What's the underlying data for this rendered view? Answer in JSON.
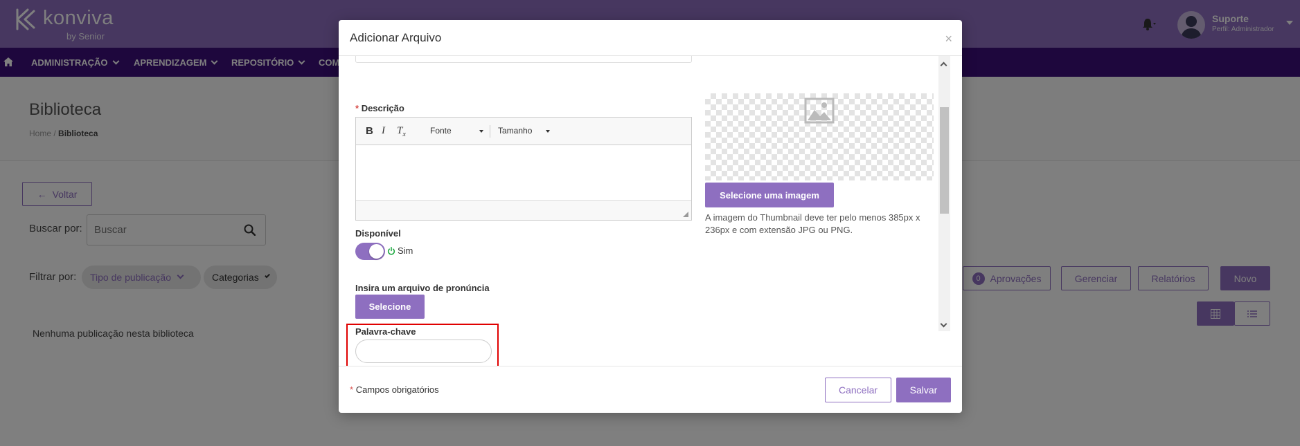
{
  "colors": {
    "brand": "#8e6fc0",
    "nav": "#3c0f7a",
    "highlight": "#e00000",
    "required": "#d9534f"
  },
  "app": {
    "logo_text": "konviva",
    "logo_by": "by Senior"
  },
  "user": {
    "name": "Suporte",
    "role": "Perfil: Administrador"
  },
  "nav": {
    "items": [
      {
        "label": "ADMINISTRAÇÃO"
      },
      {
        "label": "APRENDIZAGEM"
      },
      {
        "label": "REPOSITÓRIO"
      },
      {
        "label": "COM"
      }
    ]
  },
  "page": {
    "title": "Biblioteca",
    "breadcrumb": {
      "home": "Home",
      "sep": "/",
      "current": "Biblioteca"
    },
    "back_label": "Voltar",
    "search_label": "Buscar por:",
    "search_placeholder": "Buscar",
    "filter_label": "Filtrar por:",
    "filter_publication": "Tipo de publicação",
    "filter_categories": "Categorias",
    "approvals_count": "0",
    "approvals_label": "Aprovações",
    "manage_label": "Gerenciar",
    "reports_label": "Relatórios",
    "new_label": "Novo",
    "empty_message": "Nenhuma publicação nesta biblioteca"
  },
  "modal": {
    "title": "Adicionar Arquivo",
    "close_glyph": "×",
    "description": {
      "required_mark": "*",
      "label": "Descrição",
      "toolbar": {
        "bold": "B",
        "italic": "I",
        "clear": "Tx",
        "font": "Fonte",
        "size": "Tamanho"
      }
    },
    "available": {
      "label": "Disponível",
      "state_label": "Sim",
      "on": true
    },
    "pronunciation": {
      "label": "Insira um arquivo de pronúncia",
      "button": "Selecione"
    },
    "keyword": {
      "label": "Palavra-chave",
      "value": ""
    },
    "thumbnail": {
      "button": "Selecione uma imagem",
      "hint": "A imagem do Thumbnail deve ter pelo menos 385px x 236px e com extensão JPG ou PNG."
    },
    "required_note": {
      "mark": "*",
      "text": "Campos obrigatórios"
    },
    "cancel_label": "Cancelar",
    "save_label": "Salvar"
  }
}
